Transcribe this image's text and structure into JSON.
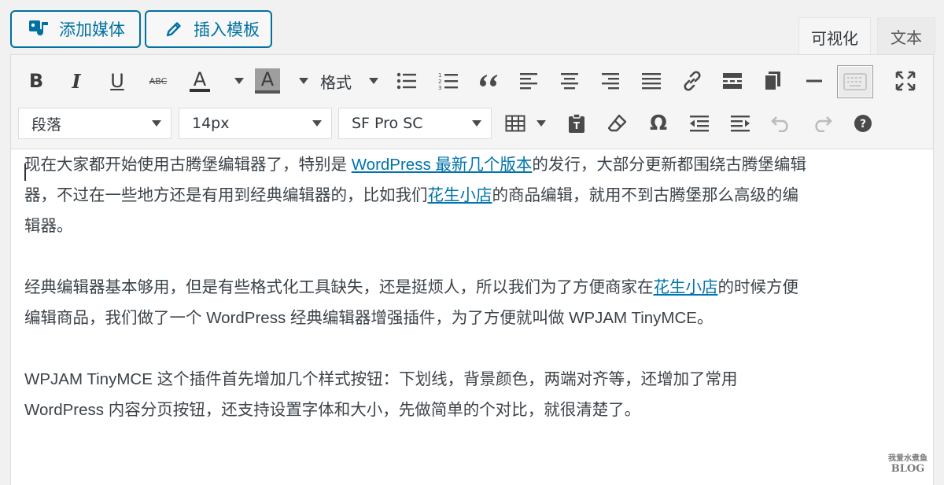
{
  "media_buttons": {
    "add_media": "添加媒体",
    "insert_template": "插入模板"
  },
  "tabs": {
    "visual": "可视化",
    "text": "文本"
  },
  "toolbar": {
    "bold": "B",
    "italic": "I",
    "underline": "U",
    "strikethrough": "ABC",
    "text_color": "A",
    "bg_color": "A",
    "formats": "格式",
    "format_select": "段落",
    "size_select": "14px",
    "font_select": "SF Pro SC"
  },
  "content": {
    "p1_a": "现在大家都开始使用古腾堡编辑器了，特别是 ",
    "p1_link": "WordPress 最新几个版本",
    "p1_b": "的发行，大部分更新都围绕古腾堡编辑器，不过在一些地方还是有用到经典编辑器的，比如我们",
    "p1_link2": "花生小店",
    "p1_c": "的商品编辑，就用不到古腾堡那么高级的编辑器。",
    "p2_a": "经典编辑器基本够用，但是有些格式化工具缺失，还是挺烦人，所以我们为了方便商家在",
    "p2_link": "花生小店",
    "p2_b": "的时候方便编辑商品，我们做了一个 WordPress 经典编辑器增强插件，为了方便就叫做 WPJAM TinyMCE。",
    "p3": "WPJAM TinyMCE 这个插件首先增加几个样式按钮：下划线，背景颜色，两端对齐等，还增加了常用 WordPress 内容分页按钮，还支持设置字体和大小，先做简单的个对比，就很清楚了。"
  },
  "watermark": {
    "line1": "我爱水煮鱼",
    "line2": "BLOG"
  },
  "colors": {
    "accent": "#0071a1",
    "link": "#0073aa",
    "text_color_bar": "#333333",
    "bg_color_swatch": "#9e9e9e"
  }
}
